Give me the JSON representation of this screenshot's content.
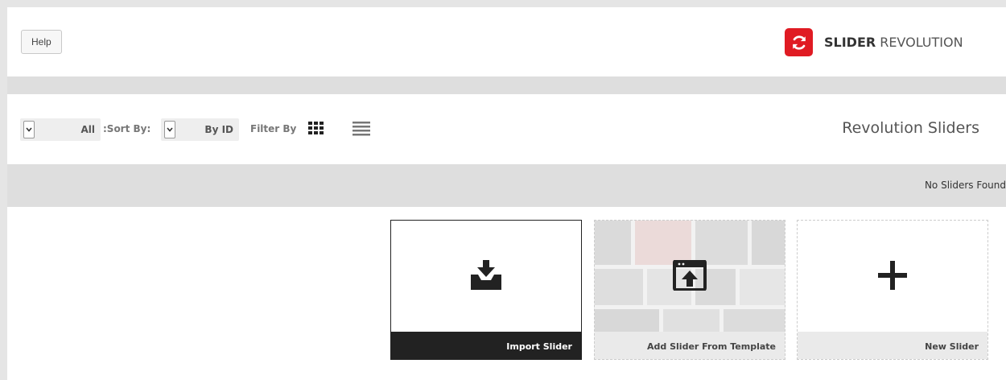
{
  "header": {
    "help_label": "Help",
    "brand": {
      "bold": "SLIDER",
      "light": "REVOLUTION",
      "logo_icon": "refresh-icon",
      "logo_color": "#e01b23"
    }
  },
  "toolbar": {
    "filter_select": {
      "value": "All"
    },
    "sort_label": ":Sort By:",
    "sort_select": {
      "value": "By ID"
    },
    "filter_label": "Filter By",
    "view_icons": [
      "grid-view-icon",
      "list-view-icon"
    ],
    "heading": "Revolution Sliders"
  },
  "status": {
    "message": "No Sliders Found"
  },
  "cards": [
    {
      "label": "Import Slider",
      "icon": "download-tray-icon"
    },
    {
      "label": "Add Slider From Template",
      "icon": "template-upload-icon"
    },
    {
      "label": "New Slider",
      "icon": "plus-icon"
    }
  ]
}
